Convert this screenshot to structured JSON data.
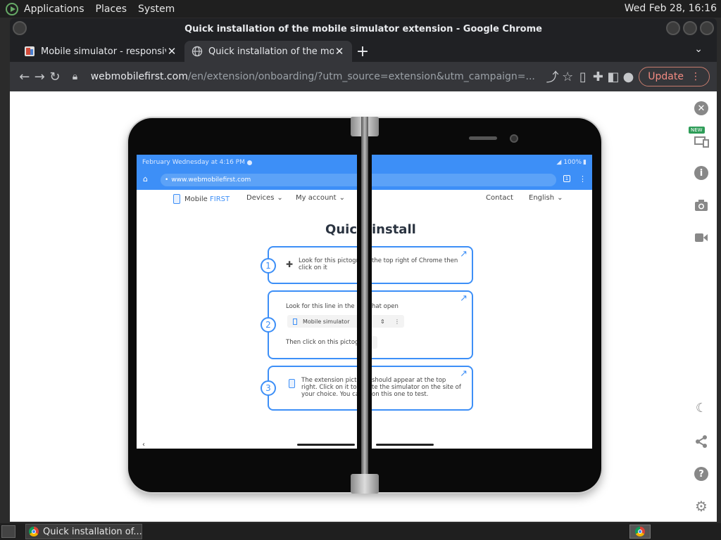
{
  "panel": {
    "menus": [
      "Applications",
      "Places",
      "System"
    ],
    "clock": "Wed Feb 28, 16:16"
  },
  "window": {
    "title": "Quick installation of the mobile simulator extension - Google Chrome"
  },
  "tabs": [
    {
      "title": "Mobile simulator - responsive",
      "active": false
    },
    {
      "title": "Quick installation of the mobile simulator extension",
      "active": true
    }
  ],
  "toolbar": {
    "url_host": "webmobilefirst.com",
    "url_path": "/en/extension/onboarding/?utm_source=extension&utm_campaign=...",
    "update_label": "Update"
  },
  "device_screen": {
    "status_left": "February Wednesday at 4:16 PM",
    "status_right": "100%",
    "address": "www.webmobilefirst.com",
    "brand": "Mobile",
    "brand_accent": "FIRST",
    "nav_devices": "Devices",
    "nav_account": "My account",
    "nav_contact": "Contact",
    "nav_language": "English",
    "heading_left": "Quic",
    "heading_right": "install",
    "step1_num": "1",
    "step1_left": "Look for this pictogra",
    "step1_left2": "click on it",
    "step1_right": "the top right of Chrome then",
    "step2_num": "2",
    "step2_line1_left": "Look for this line in the po",
    "step2_line1_right": "hat open",
    "step2_bar_label": "Mobile simulator",
    "step2_line2": "Then click on this pictogra",
    "step3_num": "3",
    "step3_left1": "The extension picto",
    "step3_left2": "right. Click on it to a",
    "step3_left3": "your choice. You can",
    "step3_right1": "should appear at the top",
    "step3_right2": "te the simulator on the site of",
    "step3_right3": "on this one to test."
  },
  "taskbar": {
    "chrome_task": "Quick installation of..."
  },
  "colors": {
    "accent": "#3d8ff7",
    "update": "#f28b82"
  }
}
